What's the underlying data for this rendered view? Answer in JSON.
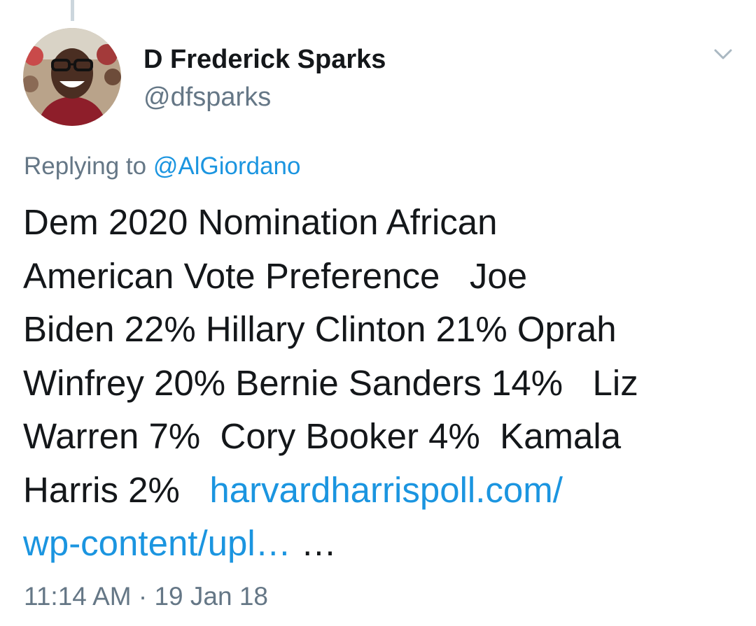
{
  "author": {
    "display_name": "D Frederick Sparks",
    "handle": "@dfsparks"
  },
  "reply": {
    "prefix": "Replying to ",
    "mention": "@AlGiordano"
  },
  "tweet": {
    "lines": [
      "Dem 2020 Nomination African",
      "American Vote Preference   Joe",
      "Biden 22% Hillary Clinton 21% Oprah",
      "Winfrey 20% Bernie Sanders 14%   Liz",
      "Warren 7%  Cory Booker 4%  Kamala",
      "Harris 2%   "
    ],
    "link_line1": "harvardharrispoll.com/",
    "link_line2": "wp-content/upl…",
    "trailing": " …"
  },
  "meta": {
    "time": "11:14 AM",
    "separator": " · ",
    "date": "19 Jan 18"
  },
  "colors": {
    "link": "#1b95e0",
    "secondary_text": "#657786",
    "primary_text": "#14171a",
    "thread_line": "#ccd6dd"
  },
  "icons": {
    "menu": "chevron-down-icon"
  }
}
